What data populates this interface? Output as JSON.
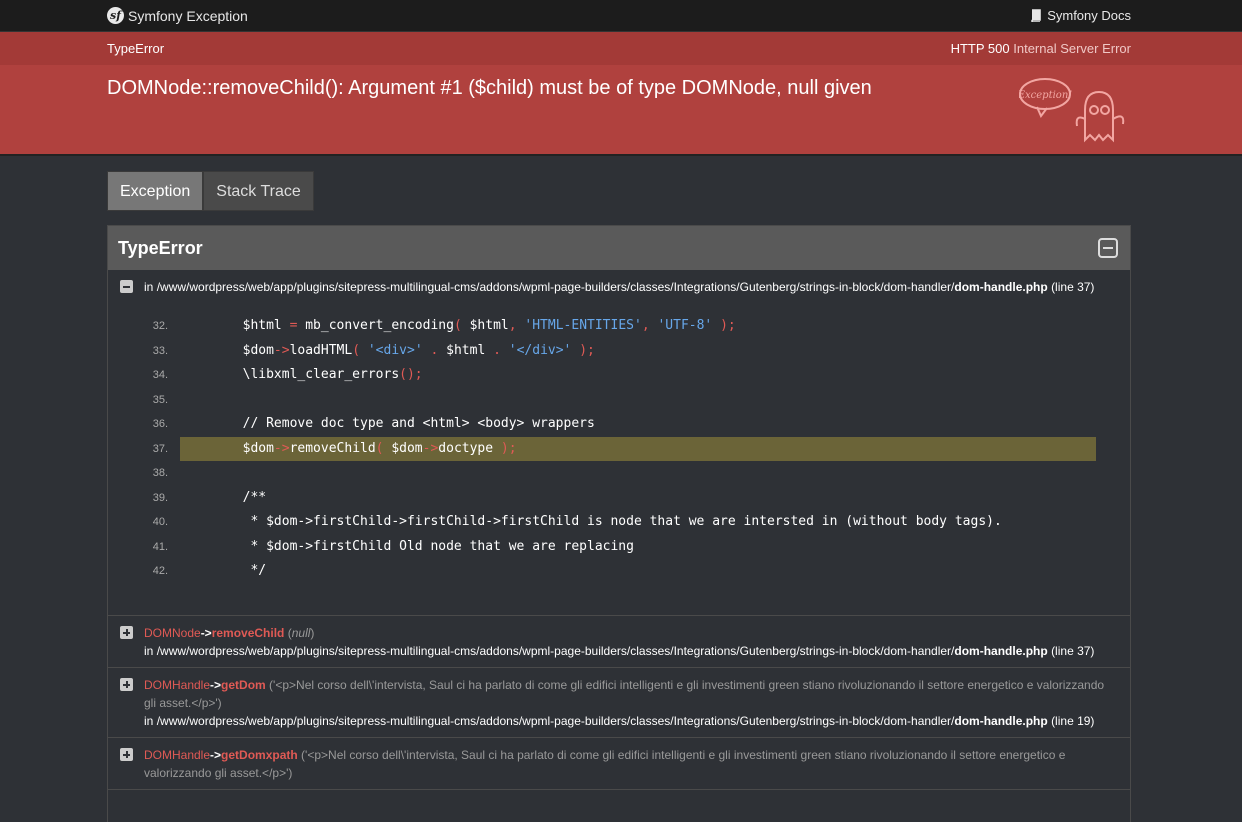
{
  "topbar": {
    "brand": "Symfony Exception",
    "docs": "Symfony Docs"
  },
  "header": {
    "exception_class": "TypeError",
    "status_code": "HTTP 500",
    "status_text": "Internal Server Error",
    "message": "DOMNode::removeChild(): Argument #1 ($child) must be of type DOMNode, null given",
    "ghost_text": "Exception!"
  },
  "tabs": [
    {
      "label": "Exception"
    },
    {
      "label": "Stack Trace"
    }
  ],
  "panel": {
    "title": "TypeError",
    "first": {
      "prefix": "in",
      "path": "/www/wordpress/web/app/plugins/sitepress-multilingual-cms/addons/wpml-page-builders/classes/Integrations/Gutenberg/strings-in-block/dom-handler/",
      "file": "dom-handle.php",
      "line": "(line 37)"
    },
    "code_lines": [
      {
        "n": "32."
      },
      {
        "n": "33."
      },
      {
        "n": "34."
      },
      {
        "n": "35."
      },
      {
        "n": "36."
      },
      {
        "n": "37."
      },
      {
        "n": "38."
      },
      {
        "n": "39."
      },
      {
        "n": "40."
      },
      {
        "n": "41."
      },
      {
        "n": "42."
      }
    ],
    "code": {
      "l32a": "        $html ",
      "l32b": "=",
      "l32c": " mb_convert_encoding",
      "l32d": "(",
      "l32e": " $html",
      "l32f": ",",
      "l32g": " 'HTML-ENTITIES'",
      "l32h": ",",
      "l32i": " 'UTF-8'",
      "l32j": " );",
      "l33a": "        $dom",
      "l33b": "->",
      "l33c": "loadHTML",
      "l33d": "(",
      "l33e": " '<div>'",
      "l33f": " .",
      "l33g": " $html",
      "l33h": " .",
      "l33i": " '</div>'",
      "l33j": " );",
      "l34a": "        \\libxml_clear_errors",
      "l34b": "();",
      "l36": "        // Remove doc type and <html> <body> wrappers",
      "l37a": "        $dom",
      "l37b": "->",
      "l37c": "removeChild",
      "l37d": "(",
      "l37e": " $dom",
      "l37f": "->",
      "l37g": "doctype",
      "l37h": " );",
      "l39": "        /**",
      "l40": "         * $dom->firstChild->firstChild->firstChild is node that we are intersted in (without body tags).",
      "l41": "         * $dom->firstChild Old node that we are replacing",
      "l42": "         */"
    },
    "trace": [
      {
        "cls": "DOMNode",
        "arrow": "->",
        "func": "removeChild",
        "args_open": " (",
        "args_inner": "null",
        "args_close": ")",
        "prefix": "in",
        "path": "/www/wordpress/web/app/plugins/sitepress-multilingual-cms/addons/wpml-page-builders/classes/Integrations/Gutenberg/strings-in-block/dom-handler/",
        "file": "dom-handle.php",
        "line": "(line 37)"
      },
      {
        "cls": "DOMHandle",
        "arrow": "->",
        "func": "getDom",
        "args": " ('<p>Nel corso dell\\'intervista, Saul ci ha parlato di come gli edifici intelligenti e gli investimenti green stiano rivoluzionando il settore energetico e valorizzando gli asset.</p>')",
        "prefix": "in",
        "path": "/www/wordpress/web/app/plugins/sitepress-multilingual-cms/addons/wpml-page-builders/classes/Integrations/Gutenberg/strings-in-block/dom-handler/",
        "file": "dom-handle.php",
        "line": "(line 19)"
      },
      {
        "cls": "DOMHandle",
        "arrow": "->",
        "func": "getDomxpath",
        "args": " ('<p>Nel corso dell\\'intervista, Saul ci ha parlato di come gli edifici intelligenti e gli investimenti green stiano rivoluzionando il settore energetico e valorizzando gli asset.</p>')"
      }
    ]
  }
}
